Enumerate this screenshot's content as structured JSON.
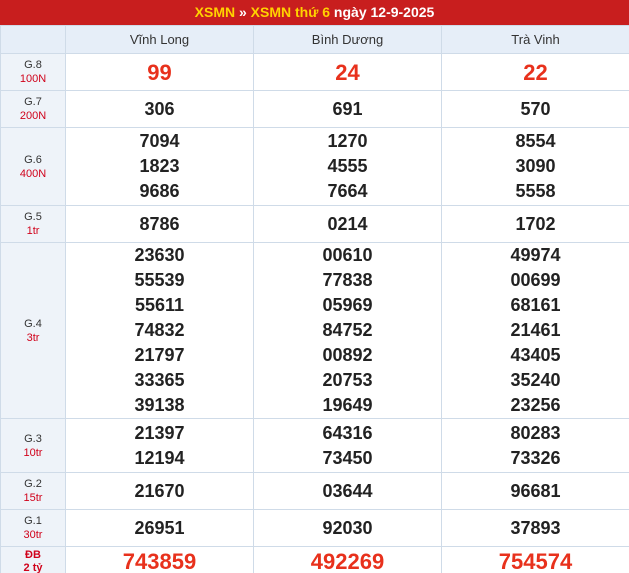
{
  "header": {
    "link1": "XSMN",
    "sep": " » ",
    "link2": "XSMN thứ 6",
    "date_text": " ngày 12-9-2025"
  },
  "columns": [
    "Vĩnh Long",
    "Bình Dương",
    "Trà Vinh"
  ],
  "prizes": {
    "g8": {
      "name": "G.8",
      "amount": "100N",
      "values": [
        [
          "99"
        ],
        [
          "24"
        ],
        [
          "22"
        ]
      ]
    },
    "g7": {
      "name": "G.7",
      "amount": "200N",
      "values": [
        [
          "306"
        ],
        [
          "691"
        ],
        [
          "570"
        ]
      ]
    },
    "g6": {
      "name": "G.6",
      "amount": "400N",
      "values": [
        [
          "7094",
          "1823",
          "9686"
        ],
        [
          "1270",
          "4555",
          "7664"
        ],
        [
          "8554",
          "3090",
          "5558"
        ]
      ]
    },
    "g5": {
      "name": "G.5",
      "amount": "1tr",
      "values": [
        [
          "8786"
        ],
        [
          "0214"
        ],
        [
          "1702"
        ]
      ]
    },
    "g4": {
      "name": "G.4",
      "amount": "3tr",
      "values": [
        [
          "23630",
          "55539",
          "55611",
          "74832",
          "21797",
          "33365",
          "39138"
        ],
        [
          "00610",
          "77838",
          "05969",
          "84752",
          "00892",
          "20753",
          "19649"
        ],
        [
          "49974",
          "00699",
          "68161",
          "21461",
          "43405",
          "35240",
          "23256"
        ]
      ]
    },
    "g3": {
      "name": "G.3",
      "amount": "10tr",
      "values": [
        [
          "21397",
          "12194"
        ],
        [
          "64316",
          "73450"
        ],
        [
          "80283",
          "73326"
        ]
      ]
    },
    "g2": {
      "name": "G.2",
      "amount": "15tr",
      "values": [
        [
          "21670"
        ],
        [
          "03644"
        ],
        [
          "96681"
        ]
      ]
    },
    "g1": {
      "name": "G.1",
      "amount": "30tr",
      "values": [
        [
          "26951"
        ],
        [
          "92030"
        ],
        [
          "37893"
        ]
      ]
    },
    "db": {
      "name": "ĐB",
      "amount": "2 tỷ",
      "values": [
        [
          "743859"
        ],
        [
          "492269"
        ],
        [
          "754574"
        ]
      ]
    }
  },
  "colors": {
    "header_bg": "#c81e1e",
    "link": "#ffd200",
    "highlight": "#e8311c",
    "amount": "#d0021b"
  }
}
